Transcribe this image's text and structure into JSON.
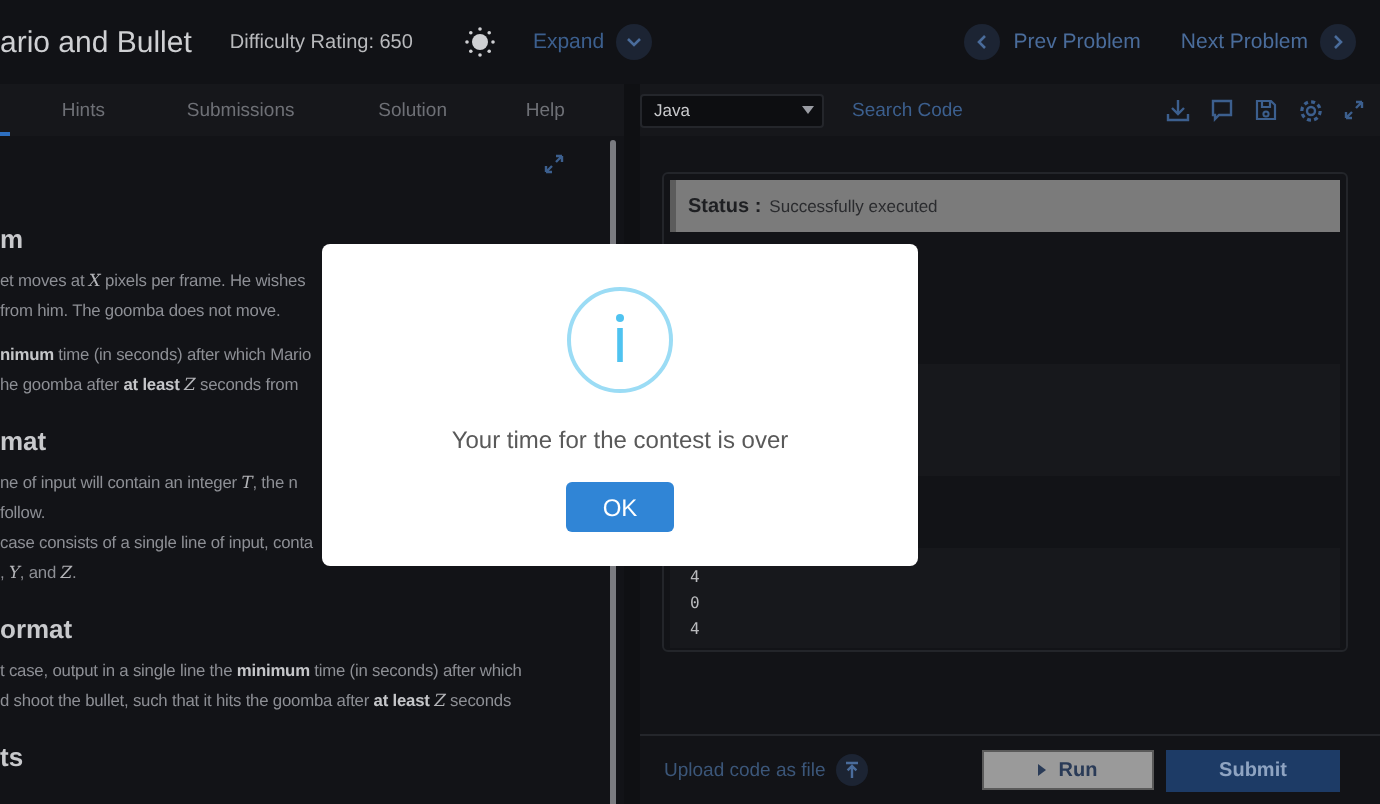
{
  "header": {
    "title": "ario and Bullet",
    "difficulty": "Difficulty Rating: 650",
    "expand": "Expand",
    "prev": "Prev Problem",
    "next": "Next Problem"
  },
  "tabs": [
    {
      "label": "Hints",
      "selected": false
    },
    {
      "label": "Submissions",
      "selected": false
    },
    {
      "label": "Solution",
      "selected": false
    },
    {
      "label": "Help",
      "selected": false
    }
  ],
  "problem": [
    {
      "kind": "heading",
      "text": "m"
    },
    {
      "kind": "paragraph",
      "lines": [
        "et moves at *X* pixels per frame. He wishes",
        "from him. The goomba does not move."
      ]
    },
    {
      "kind": "paragraph",
      "lines": [
        "**nimum** time (in seconds) after which Mario",
        "he goomba after **at least** *Z* seconds from"
      ]
    },
    {
      "kind": "heading",
      "text": "mat"
    },
    {
      "kind": "paragraph",
      "lines": [
        "ne of input will contain an integer *T*, the n",
        "follow.",
        "case consists of a single line of input, conta",
        ", *Y*, and *Z*."
      ]
    },
    {
      "kind": "heading",
      "text": "ormat"
    },
    {
      "kind": "paragraph",
      "lines": [
        "t case, output in a single line the **minimum** time (in seconds) after which",
        "d shoot the bullet, such that it hits the goomba after **at least** *Z* seconds"
      ]
    },
    {
      "kind": "heading",
      "text": "ts"
    }
  ],
  "editor": {
    "language": "Java",
    "search": "Search Code",
    "status_label": "Status :",
    "status": "Successfully executed",
    "output": [
      "4",
      "0",
      "4"
    ],
    "upload": "Upload code as file",
    "run": "Run",
    "submit": "Submit"
  },
  "dialog": {
    "message": "Your time for the contest is over",
    "button": "OK"
  }
}
